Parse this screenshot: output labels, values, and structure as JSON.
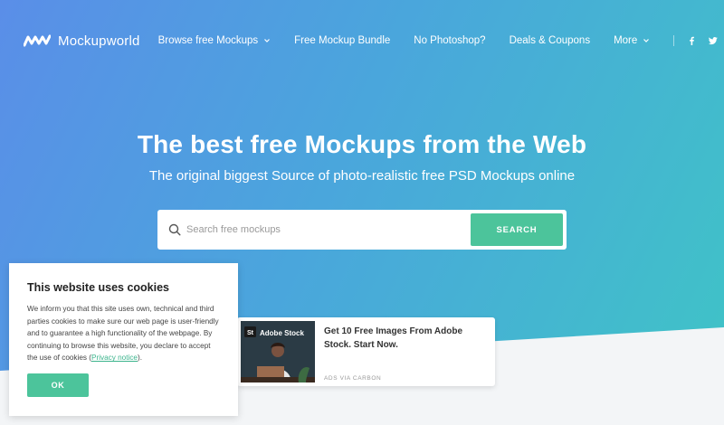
{
  "brand": {
    "name": "Mockupworld",
    "logo_icon": "mw-logo-icon"
  },
  "nav": {
    "items": [
      {
        "label": "Browse free Mockups",
        "has_dropdown": true
      },
      {
        "label": "Free Mockup Bundle",
        "has_dropdown": false
      },
      {
        "label": "No Photoshop?",
        "has_dropdown": false
      },
      {
        "label": "Deals & Coupons",
        "has_dropdown": false
      },
      {
        "label": "More",
        "has_dropdown": true
      }
    ],
    "social": [
      "facebook-icon",
      "twitter-icon"
    ]
  },
  "hero": {
    "title": "The best free Mockups from the Web",
    "subtitle": "The original biggest Source of photo-realistic free PSD Mockups online"
  },
  "search": {
    "placeholder": "Search free mockups",
    "button_label": "SEARCH"
  },
  "ad": {
    "image_label": "Adobe Stock",
    "badge": "St",
    "headline": "Get 10 Free Images From Adobe Stock. Start Now.",
    "via": "ADS VIA CARBON"
  },
  "cookie": {
    "title": "This website uses cookies",
    "text_before": "We inform you that this site uses own, technical and third parties cookies to make sure our web page is user-friendly and to guarantee a high functionality of the webpage. By continuing to browse this website, you declare to accept the use of cookies (",
    "link": "Privacy notice",
    "text_after": ").",
    "ok_label": "OK"
  },
  "colors": {
    "accent": "#4cc49b",
    "gradient_start": "#5a8ee8",
    "gradient_end": "#3fc4c6",
    "section_bg": "#f3f5f7"
  }
}
